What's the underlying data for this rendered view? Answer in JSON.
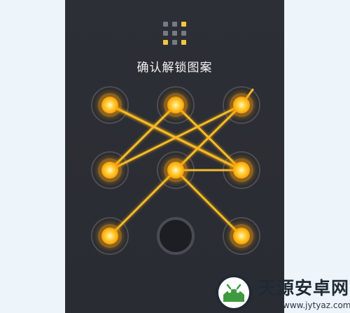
{
  "screen": {
    "title": "确认解锁图案",
    "background": "#2b2d34",
    "accent": "#ffb000"
  },
  "pattern_grid": {
    "rows": 3,
    "cols": 3,
    "selected_nodes": [
      1,
      2,
      3,
      4,
      5,
      6,
      7,
      9
    ],
    "unselected_nodes": [
      8
    ],
    "connections": [
      [
        1,
        6
      ],
      [
        6,
        5
      ],
      [
        5,
        9
      ],
      [
        2,
        4
      ],
      [
        4,
        3
      ],
      [
        3,
        5
      ],
      [
        5,
        7
      ],
      [
        1,
        6
      ],
      [
        2,
        6
      ]
    ]
  },
  "preview_grid": {
    "highlighted": [
      3,
      7,
      9
    ]
  },
  "watermark": {
    "name": "天源安卓网",
    "url": "www.jytyaz.com",
    "logo_icon": "android-robot-icon",
    "colors": {
      "logo_green": "#3d9a3f",
      "logo_dark": "#1f2a33"
    }
  }
}
